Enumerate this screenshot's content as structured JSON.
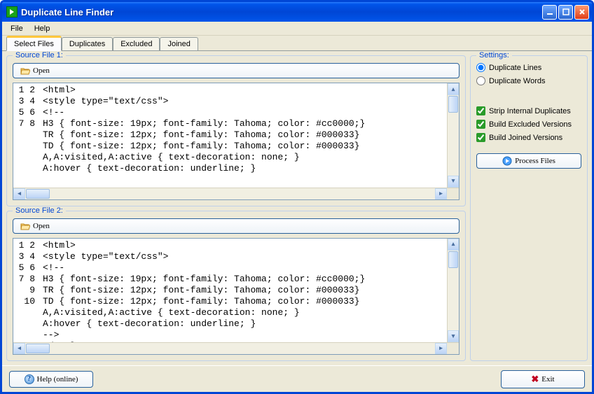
{
  "title": "Duplicate Line Finder",
  "menu": {
    "file": "File",
    "help": "Help"
  },
  "tabs": {
    "select": "Select Files",
    "dup": "Duplicates",
    "excl": "Excluded",
    "join": "Joined"
  },
  "source1": {
    "legend": "Source File 1:",
    "open": "Open",
    "lines": [
      "<html>",
      "<style type=\"text/css\">",
      "<!--",
      "H3 { font-size: 19px; font-family: Tahoma; color: #cc0000;}",
      "TR { font-size: 12px; font-family: Tahoma; color: #000033}",
      "TD { font-size: 12px; font-family: Tahoma; color: #000033}",
      "A,A:visited,A:active { text-decoration: none; }",
      "A:hover { text-decoration: underline; }"
    ]
  },
  "source2": {
    "legend": "Source File 2:",
    "open": "Open",
    "lines": [
      "<html>",
      "<style type=\"text/css\">",
      "<!--",
      "H3 { font-size: 19px; font-family: Tahoma; color: #cc0000;}",
      "TR { font-size: 12px; font-family: Tahoma; color: #000033}",
      "TD { font-size: 12px; font-family: Tahoma; color: #000033}",
      "A,A:visited,A:active { text-decoration: none; }",
      "A:hover { text-decoration: underline; }",
      "-->",
      "</style>"
    ]
  },
  "settings": {
    "legend": "Settings:",
    "dup_lines": "Duplicate Lines",
    "dup_words": "Duplicate Words",
    "strip": "Strip Internal Duplicates",
    "excl": "Build Excluded Versions",
    "join": "Build Joined Versions",
    "process": "Process Files"
  },
  "bottom": {
    "help": "Help (online)",
    "exit": "Exit"
  }
}
